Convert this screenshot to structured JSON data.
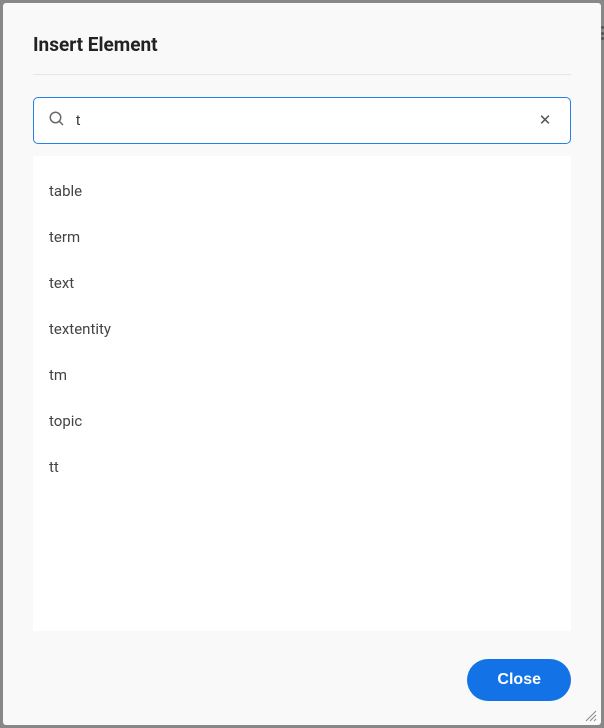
{
  "dialog": {
    "title": "Insert Element",
    "search": {
      "value": "t",
      "placeholder": ""
    },
    "results": [
      "table",
      "term",
      "text",
      "textentity",
      "tm",
      "topic",
      "tt"
    ],
    "closeLabel": "Close"
  }
}
